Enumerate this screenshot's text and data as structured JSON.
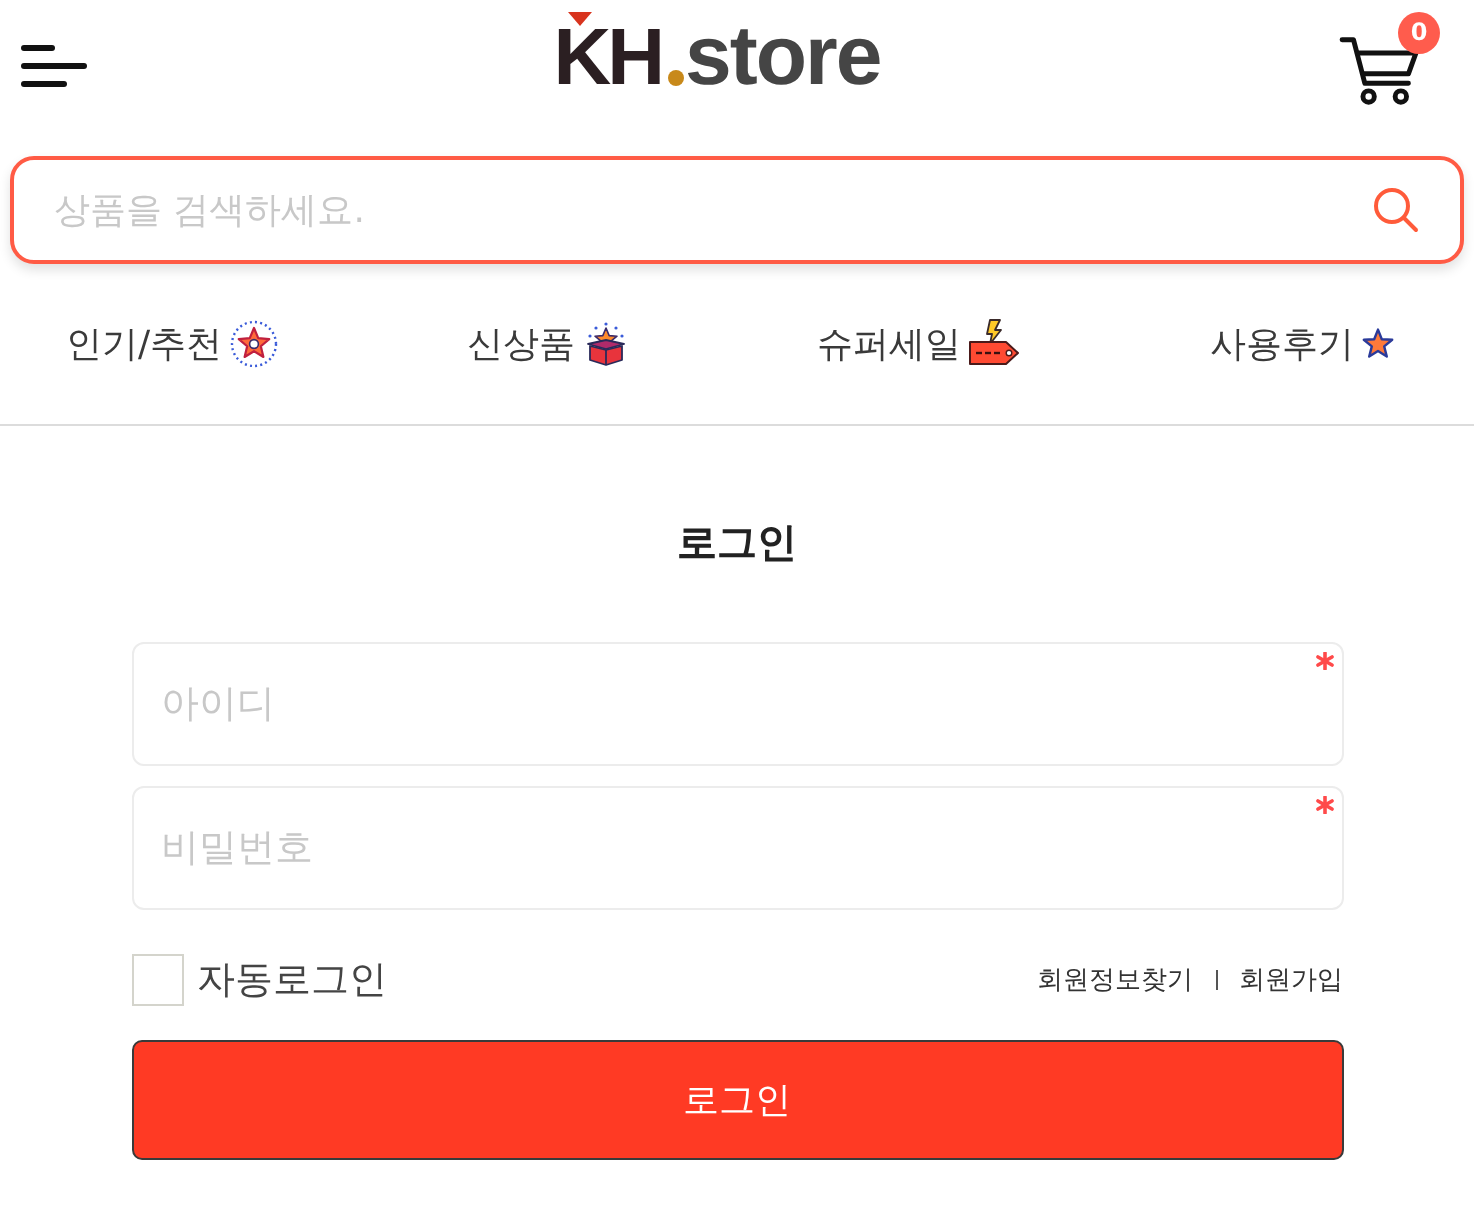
{
  "header": {
    "logo": {
      "mark": "KH",
      "name": "store"
    },
    "cart": {
      "count": "0"
    }
  },
  "search": {
    "placeholder": "상품을 검색하세요."
  },
  "categories": [
    {
      "label": "인기/추천"
    },
    {
      "label": "신상품"
    },
    {
      "label": "슈퍼세일"
    },
    {
      "label": "사용후기"
    }
  ],
  "login": {
    "title": "로그인",
    "fields": [
      {
        "placeholder": "아이디",
        "required": true
      },
      {
        "placeholder": "비밀번호",
        "required": true
      }
    ],
    "auto_login": {
      "label": "자동로그인",
      "checked": false
    },
    "links": [
      "회원정보찾기",
      "회원가입"
    ],
    "submit": "로그인"
  }
}
